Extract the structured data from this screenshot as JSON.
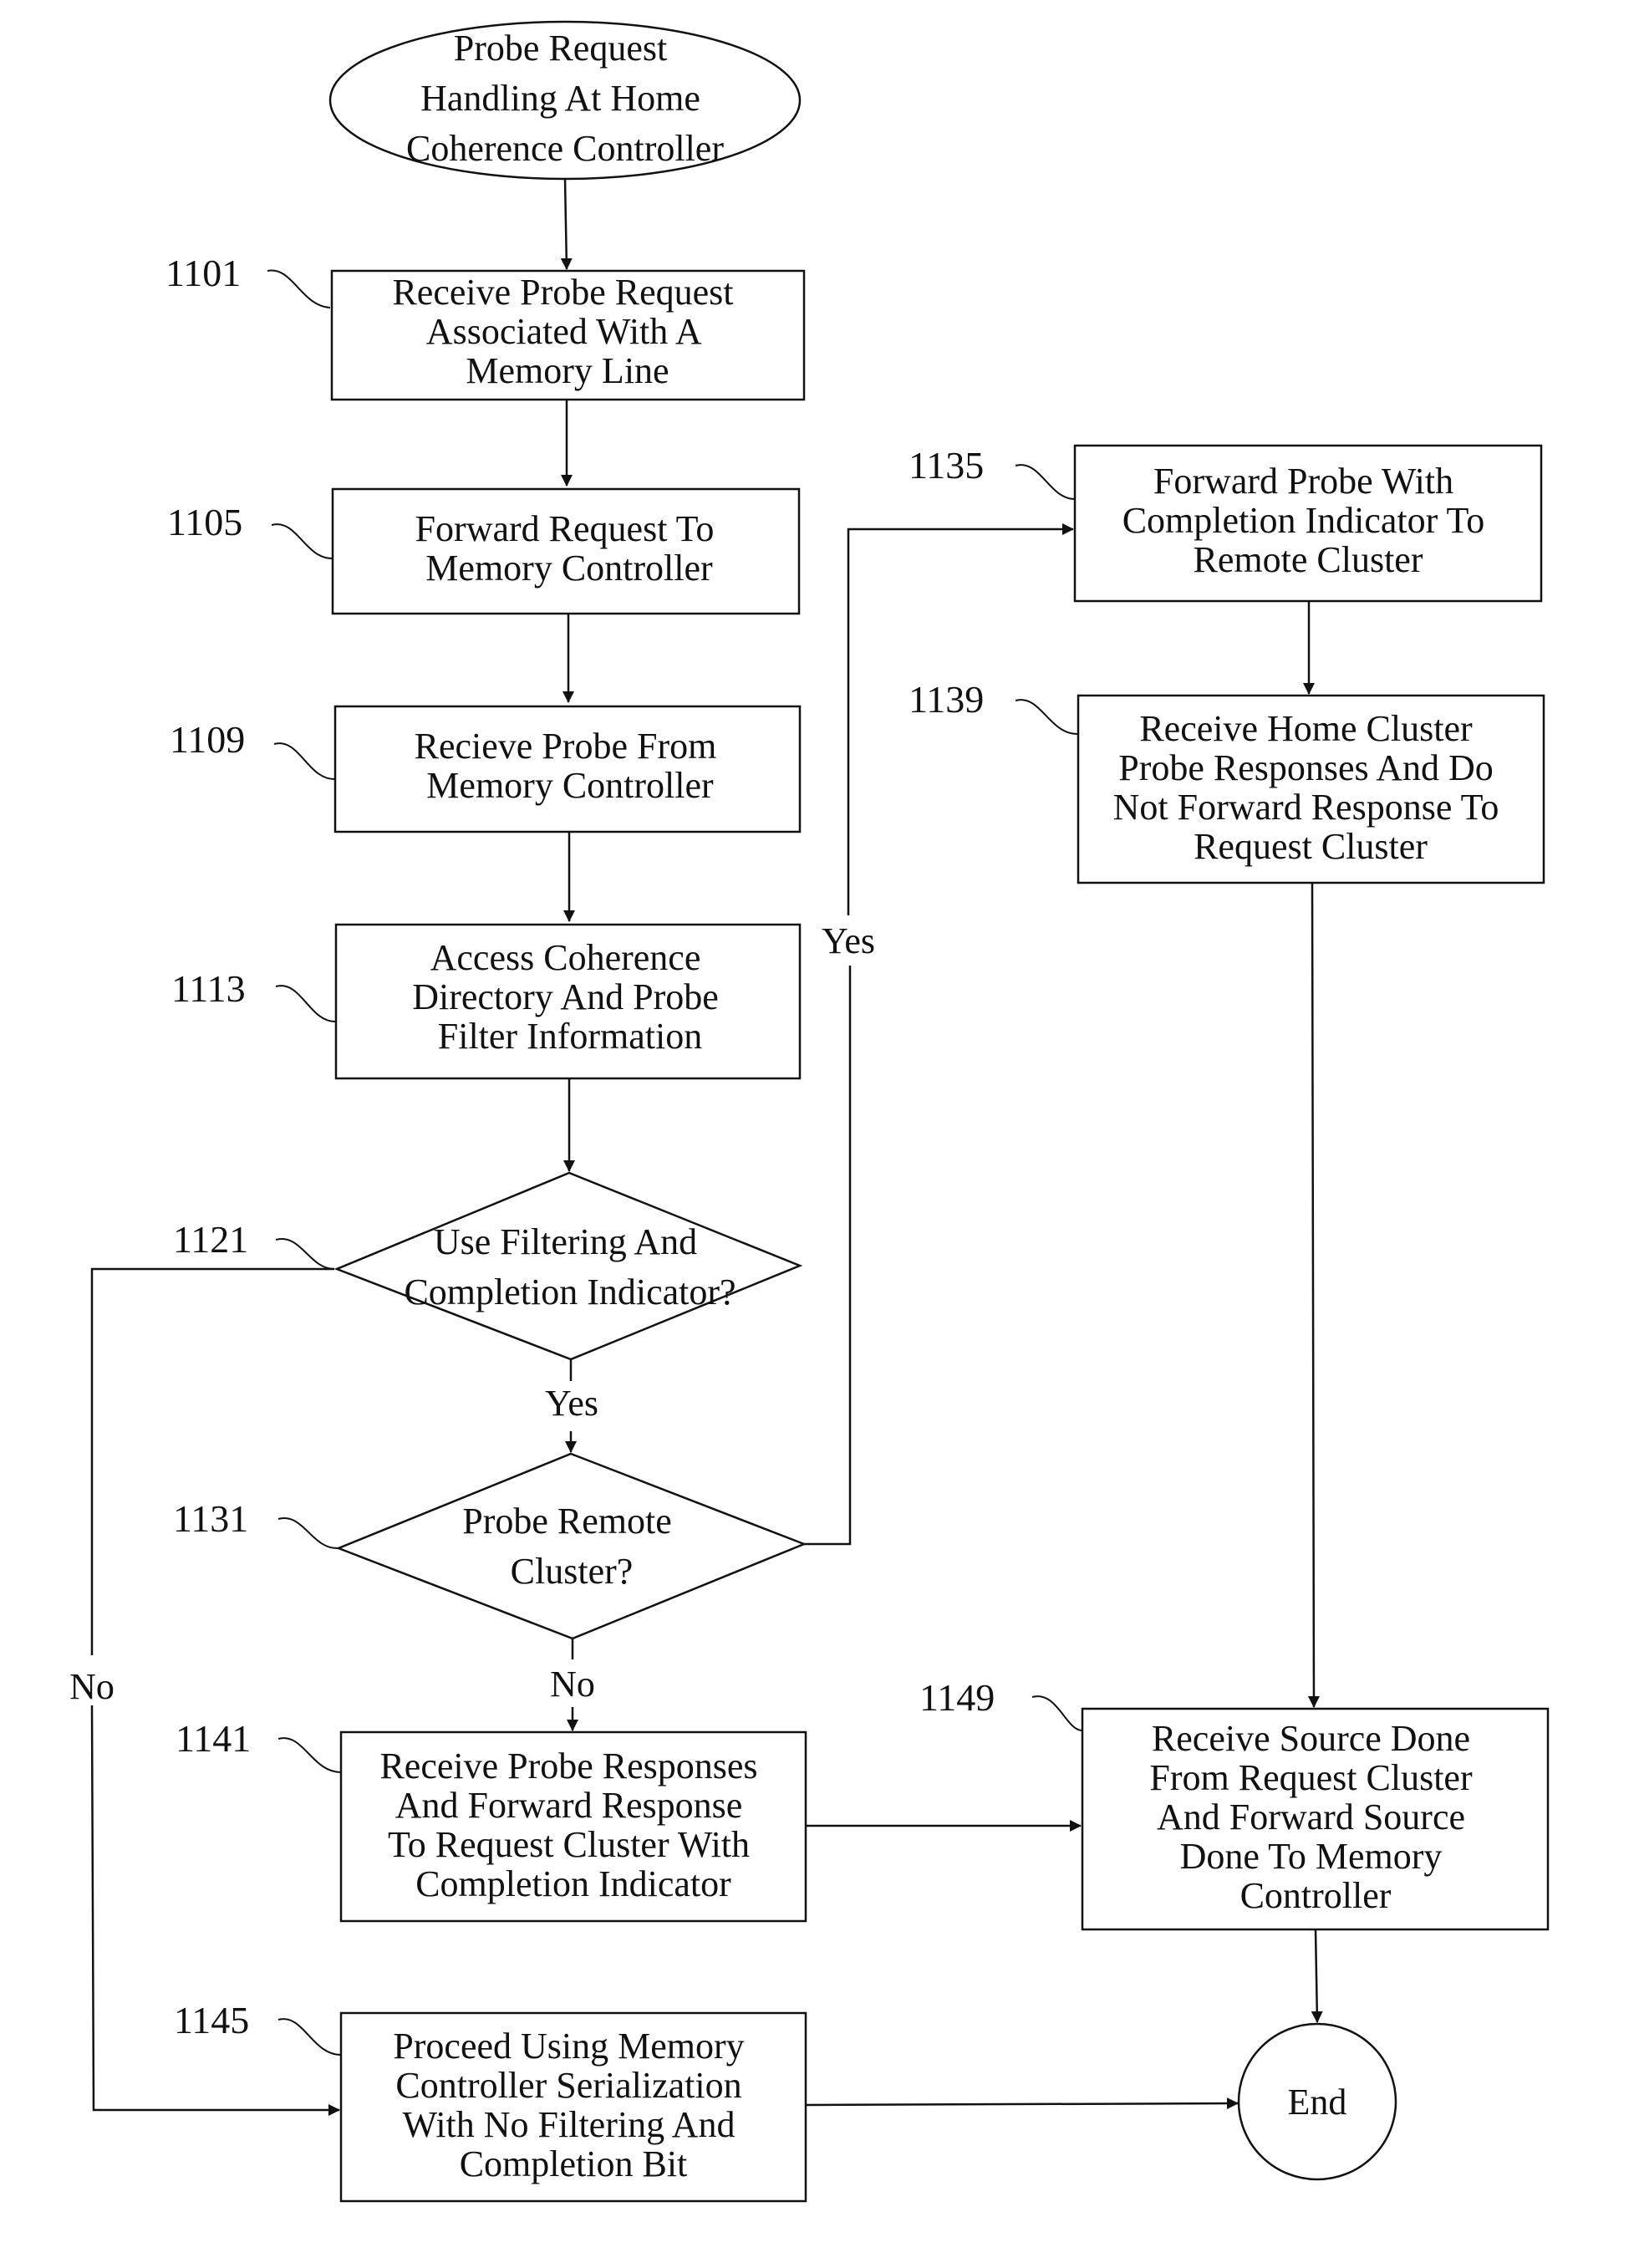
{
  "diagram": {
    "type": "flowchart",
    "start": {
      "lines": [
        "Probe Request",
        "Handling At Home",
        "Coherence Controller"
      ]
    },
    "steps": [
      {
        "id": "1101",
        "ref": "1101",
        "lines": [
          "Receive Probe Request",
          "Associated With A",
          "Memory Line"
        ]
      },
      {
        "id": "1105",
        "ref": "1105",
        "lines": [
          "Forward Request To",
          "Memory Controller"
        ]
      },
      {
        "id": "1109",
        "ref": "1109",
        "lines": [
          "Recieve Probe From",
          "Memory Controller"
        ]
      },
      {
        "id": "1113",
        "ref": "1113",
        "lines": [
          "Access Coherence",
          "Directory And Probe",
          "Filter Information"
        ]
      },
      {
        "id": "1121",
        "ref": "1121",
        "lines": [
          "Use Filtering And",
          "Completion Indicator?"
        ]
      },
      {
        "id": "1131",
        "ref": "1131",
        "lines": [
          "Probe Remote",
          "Cluster?"
        ]
      },
      {
        "id": "1135",
        "ref": "1135",
        "lines": [
          "Forward Probe With",
          "Completion Indicator To",
          "Remote Cluster"
        ]
      },
      {
        "id": "1139",
        "ref": "1139",
        "lines": [
          "Receive Home Cluster",
          "Probe Responses And Do",
          "Not Forward Response To",
          "Request Cluster"
        ]
      },
      {
        "id": "1141",
        "ref": "1141",
        "lines": [
          "Receive Probe Responses",
          "And Forward Response",
          "To Request Cluster With",
          "Completion Indicator"
        ]
      },
      {
        "id": "1145",
        "ref": "1145",
        "lines": [
          "Proceed Using Memory",
          "Controller Serialization",
          "With No Filtering And",
          "Completion Bit"
        ]
      },
      {
        "id": "1149",
        "ref": "1149",
        "lines": [
          "Receive Source Done",
          "From Request Cluster",
          "And Forward Source",
          "Done To Memory",
          "Controller"
        ]
      }
    ],
    "end": {
      "label": "End"
    },
    "edge_labels": {
      "d1121_yes": "Yes",
      "d1121_no": "No",
      "d1131_yes": "Yes",
      "d1131_no": "No"
    },
    "edges": [
      {
        "from": "start",
        "to": "1101"
      },
      {
        "from": "1101",
        "to": "1105"
      },
      {
        "from": "1105",
        "to": "1109"
      },
      {
        "from": "1109",
        "to": "1113"
      },
      {
        "from": "1113",
        "to": "1121"
      },
      {
        "from": "1121",
        "to": "1131",
        "label": "Yes"
      },
      {
        "from": "1121",
        "to": "1145",
        "label": "No"
      },
      {
        "from": "1131",
        "to": "1135",
        "label": "Yes"
      },
      {
        "from": "1131",
        "to": "1141",
        "label": "No"
      },
      {
        "from": "1135",
        "to": "1139"
      },
      {
        "from": "1139",
        "to": "1149"
      },
      {
        "from": "1141",
        "to": "1149"
      },
      {
        "from": "1145",
        "to": "end"
      },
      {
        "from": "1149",
        "to": "end"
      }
    ]
  }
}
